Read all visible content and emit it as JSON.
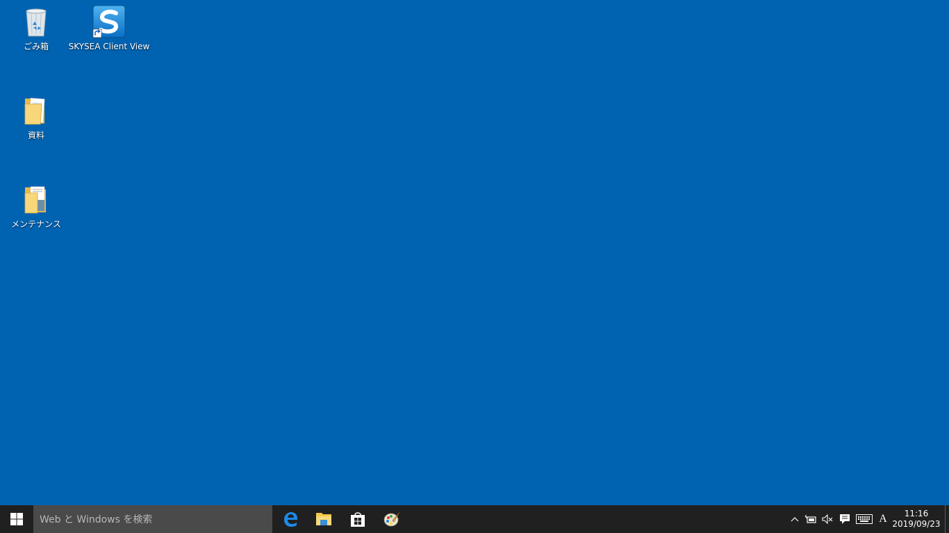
{
  "desktop": {
    "background_color": "#0063b1",
    "icons": [
      {
        "label": "ごみ箱",
        "icon": "recycle-bin-icon"
      },
      {
        "label": "SKYSEA Client View",
        "icon": "skysea-app-icon"
      },
      {
        "label": "資料",
        "icon": "folder-icon"
      },
      {
        "label": "メンテナンス",
        "icon": "folder-icon"
      }
    ]
  },
  "taskbar": {
    "background_color": "#202020",
    "search": {
      "placeholder": "Web と Windows を検索"
    },
    "pinned_apps": [
      {
        "name": "Microsoft Edge",
        "icon": "edge-icon"
      },
      {
        "name": "File Explorer",
        "icon": "file-explorer-icon"
      },
      {
        "name": "Store",
        "icon": "store-icon"
      },
      {
        "name": "Paint",
        "icon": "paint-icon"
      }
    ],
    "tray": {
      "ime_mode": "A",
      "time": "11:16",
      "date": "2019/09/23"
    }
  }
}
